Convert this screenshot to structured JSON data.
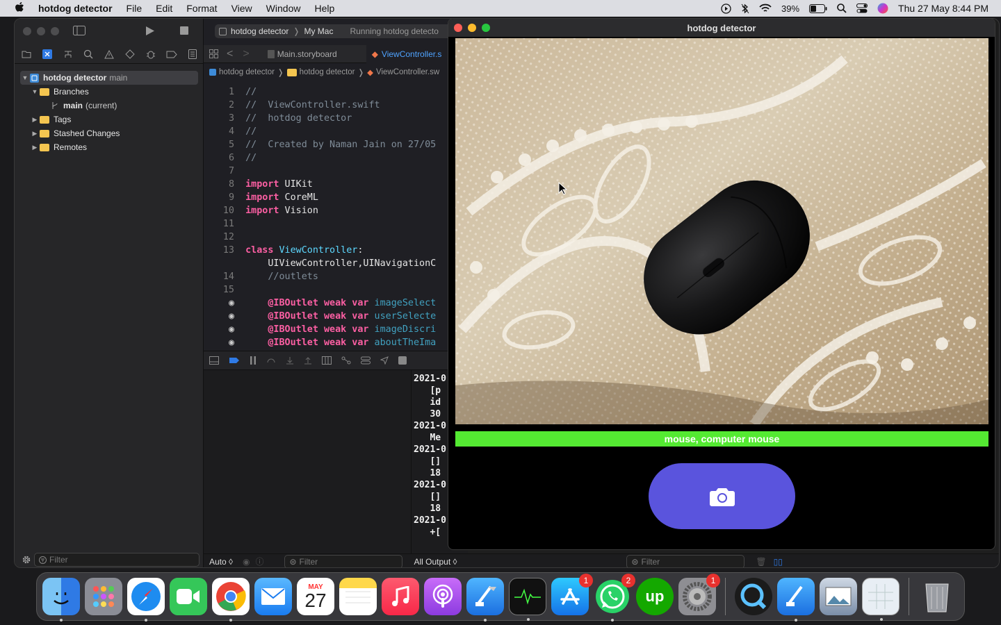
{
  "menubar": {
    "apple": "",
    "app": "hotdog detector",
    "items": [
      "File",
      "Edit",
      "Format",
      "View",
      "Window",
      "Help"
    ],
    "battery": "39%",
    "datetime": "Thu 27 May  8:44 PM"
  },
  "xcode": {
    "toolbar": {
      "scheme": "hotdog detector",
      "destination": "My Mac",
      "status": "Running hotdog detecto"
    },
    "tabs": [
      "Main.storyboard",
      "ViewController.s"
    ],
    "breadcrumb": [
      "hotdog detector",
      "hotdog detector",
      "ViewController.sw"
    ],
    "tree": {
      "repo": "hotdog detector",
      "repo_branch": "main",
      "branches": "Branches",
      "branch_main": "main",
      "branch_current": "(current)",
      "tags": "Tags",
      "stashed": "Stashed Changes",
      "remotes": "Remotes"
    },
    "code": [
      {
        "n": "1",
        "t": "//"
      },
      {
        "n": "2",
        "t": "//  ViewController.swift"
      },
      {
        "n": "3",
        "t": "//  hotdog detector"
      },
      {
        "n": "4",
        "t": "//"
      },
      {
        "n": "5",
        "t": "//  Created by Naman Jain on 27/05"
      },
      {
        "n": "6",
        "t": "//"
      },
      {
        "n": "7",
        "t": ""
      },
      {
        "n": "8",
        "k": "import",
        "r": " UIKit"
      },
      {
        "n": "9",
        "k": "import",
        "r": " CoreML"
      },
      {
        "n": "10",
        "k": "import",
        "r": " Vision"
      },
      {
        "n": "11",
        "t": ""
      },
      {
        "n": "12",
        "t": ""
      },
      {
        "n": "13",
        "k": "class",
        "c": " ViewController",
        "r": ":"
      },
      {
        "n": "",
        "c2": "    UIViewController,UINavigationC"
      },
      {
        "n": "14",
        "t": "    //outlets"
      },
      {
        "n": "15",
        "t": ""
      },
      {
        "n": "bp",
        "k": "    @IBOutlet weak var",
        "o": " imageSelect"
      },
      {
        "n": "bp",
        "k": "    @IBOutlet weak var",
        "o": " userSelecte"
      },
      {
        "n": "bp",
        "k": "    @IBOutlet weak var",
        "o": " imageDiscri"
      },
      {
        "n": "bp",
        "k": "    @IBOutlet weak var",
        "o": " aboutTheIma"
      }
    ],
    "console": [
      "2021-0",
      "   [p",
      "   id",
      "   30",
      "2021-0",
      "   Me",
      "2021-0",
      "   []",
      "   18",
      "2021-0",
      "   []",
      "   18",
      "2021-0",
      "   +["
    ],
    "nav_filter": "Filter",
    "debug_auto": "Auto ◊",
    "debug_filter": "Filter",
    "console_output": "All Output ◊",
    "console_filter": "Filter"
  },
  "simulator": {
    "title": "hotdog detector",
    "result": "mouse, computer mouse",
    "camera_icon": "camera-icon"
  },
  "dock": {
    "calendar_month": "MAY",
    "calendar_day": "27",
    "badges": {
      "appstore": "1",
      "whatsapp": "2",
      "settings": "1"
    },
    "upwork": "up"
  }
}
